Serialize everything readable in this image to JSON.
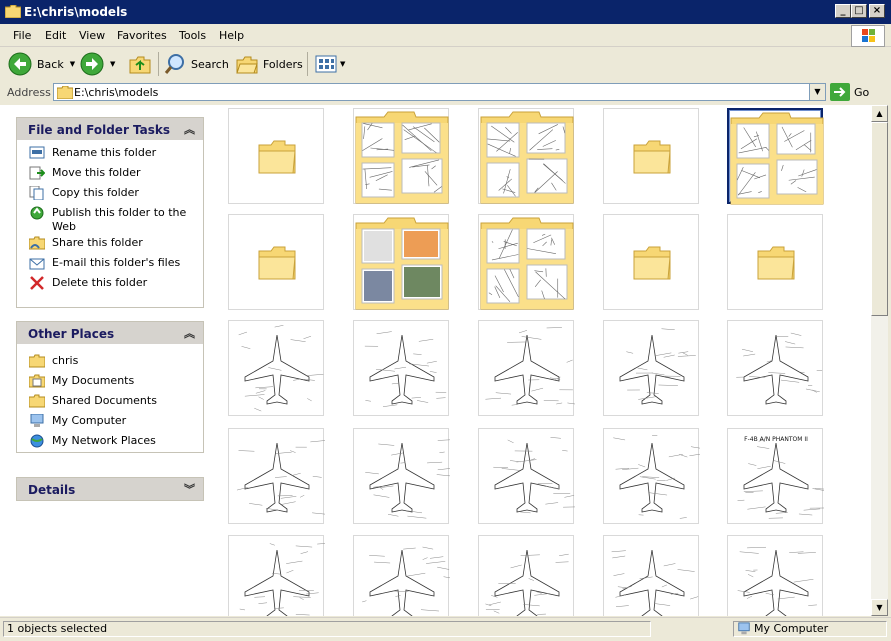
{
  "window": {
    "title": "E:\\chris\\models",
    "controls": [
      "minimize",
      "maximize",
      "close"
    ]
  },
  "menu": {
    "items": [
      {
        "label": "File"
      },
      {
        "label": "Edit"
      },
      {
        "label": "View"
      },
      {
        "label": "Favorites"
      },
      {
        "label": "Tools"
      },
      {
        "label": "Help"
      }
    ]
  },
  "toolbar": {
    "back_label": "Back",
    "search_label": "Search",
    "folders_label": "Folders"
  },
  "address": {
    "label": "Address",
    "value": "E:\\chris\\models",
    "go_label": "Go"
  },
  "tasks": {
    "file_folder": {
      "title": "File and Folder Tasks",
      "items": [
        {
          "label": "Rename this folder",
          "icon": "rename-icon"
        },
        {
          "label": "Move this folder",
          "icon": "move-icon"
        },
        {
          "label": "Copy this folder",
          "icon": "copy-icon"
        },
        {
          "label": "Publish this folder to the Web",
          "icon": "publish-web-icon"
        },
        {
          "label": "Share this folder",
          "icon": "share-icon"
        },
        {
          "label": "E-mail this folder's files",
          "icon": "email-icon"
        },
        {
          "label": "Delete this folder",
          "icon": "delete-icon"
        }
      ]
    },
    "other_places": {
      "title": "Other Places",
      "items": [
        {
          "label": "chris",
          "icon": "folder-icon"
        },
        {
          "label": "My Documents",
          "icon": "my-documents-icon"
        },
        {
          "label": "Shared Documents",
          "icon": "folder-icon"
        },
        {
          "label": "My Computer",
          "icon": "my-computer-icon"
        },
        {
          "label": "My Network Places",
          "icon": "network-places-icon"
        }
      ]
    },
    "details": {
      "title": "Details"
    }
  },
  "thumbnails": [
    {
      "kind": "folder-empty"
    },
    {
      "kind": "folder-content"
    },
    {
      "kind": "folder-content"
    },
    {
      "kind": "folder-empty"
    },
    {
      "kind": "folder-content",
      "selected": true
    },
    {
      "kind": "folder-empty"
    },
    {
      "kind": "folder-photo"
    },
    {
      "kind": "folder-content"
    },
    {
      "kind": "folder-empty"
    },
    {
      "kind": "folder-empty"
    },
    {
      "kind": "drawing"
    },
    {
      "kind": "drawing"
    },
    {
      "kind": "drawing"
    },
    {
      "kind": "drawing"
    },
    {
      "kind": "drawing"
    },
    {
      "kind": "drawing"
    },
    {
      "kind": "drawing"
    },
    {
      "kind": "drawing"
    },
    {
      "kind": "drawing"
    },
    {
      "kind": "drawing",
      "caption": "F-4B A/N    PHANTOM II"
    },
    {
      "kind": "drawing"
    },
    {
      "kind": "drawing"
    },
    {
      "kind": "drawing"
    },
    {
      "kind": "drawing"
    },
    {
      "kind": "drawing"
    }
  ],
  "status": {
    "left": "1 objects selected",
    "right": "My Computer"
  },
  "colors": {
    "titlebar": "#0a246a",
    "folder": "#f7d774",
    "chrome": "#ece9d8"
  }
}
